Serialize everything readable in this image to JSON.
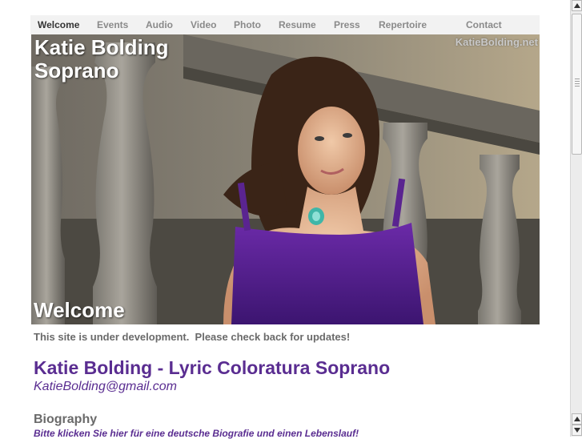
{
  "nav": {
    "items": [
      {
        "label": "Welcome",
        "active": true
      },
      {
        "label": "Events"
      },
      {
        "label": "Audio"
      },
      {
        "label": "Video"
      },
      {
        "label": "Photo"
      },
      {
        "label": "Resume"
      },
      {
        "label": "Press"
      },
      {
        "label": "Repertoire"
      },
      {
        "label": "Contact"
      }
    ]
  },
  "hero": {
    "title_line1": "Katie Bolding",
    "title_line2": "Soprano",
    "watermark": "KatieBolding.net",
    "caption": "Welcome"
  },
  "content": {
    "notice": "This site is under development.  Please check back for updates!",
    "main_heading": "Katie Bolding - Lyric Coloratura Soprano",
    "email": "KatieBolding@gmail.com",
    "bio_heading": "Biography",
    "bio_link": "Bitte klicken Sie hier für eine deutsche Biografie und einen Lebenslauf!"
  },
  "colors": {
    "accent": "#5a2d91",
    "nav_bg": "#f2f2f2",
    "nav_text": "#8a8a8a",
    "nav_active": "#333333"
  }
}
